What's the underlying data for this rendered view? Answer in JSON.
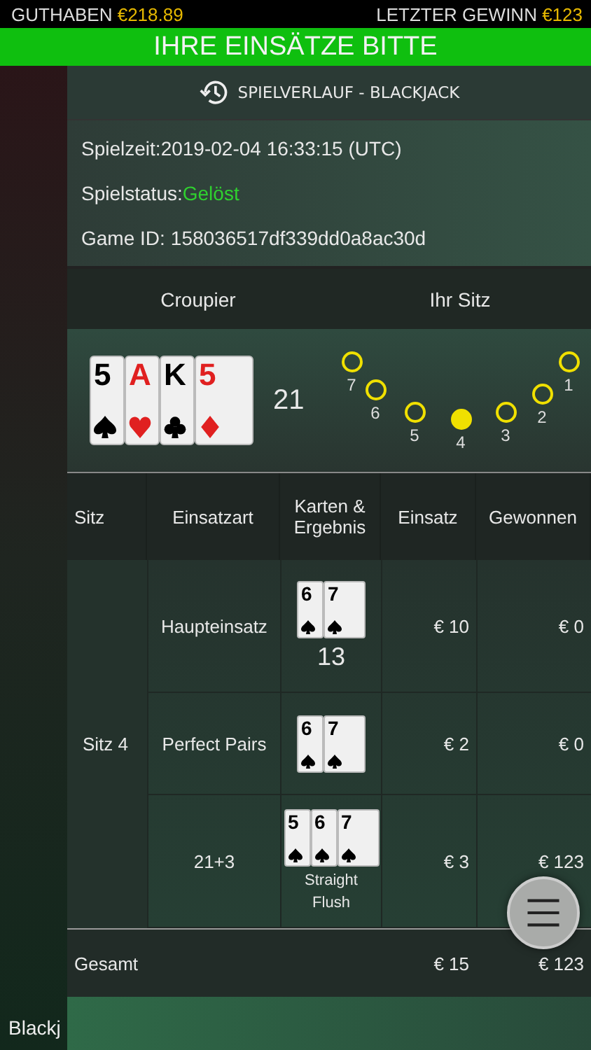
{
  "top_bar": {
    "balance_label": "GUTHABEN",
    "balance": "€218.89",
    "last_win_label": "LETZTER GEWINN",
    "last_win": "€123"
  },
  "banner": "IHRE EINSÄTZE BITTE",
  "panel": {
    "title": "SPIELVERLAUF - BLACKJACK",
    "info": [
      {
        "label": "Spielzeit:",
        "value": "2019-02-04 16:33:15 (UTC)",
        "kind": "plain"
      },
      {
        "label": "Spielstatus:",
        "value": "Gelöst",
        "kind": "status"
      },
      {
        "label": "Game ID:",
        "value": "158036517df339dd0a8ac30d",
        "kind": "plain"
      }
    ],
    "hand": {
      "columns": [
        "Croupier",
        "Ihr Sitz"
      ],
      "dealer_cards": [
        {
          "rank": "5",
          "kind": "spades"
        },
        {
          "rank": "A",
          "kind": "hearts"
        },
        {
          "rank": "K",
          "kind": "clubs"
        },
        {
          "rank": "5",
          "kind": "diamonds"
        }
      ],
      "dealer_total": "21",
      "seats": [
        {
          "label": "1",
          "selected": false
        },
        {
          "label": "2",
          "selected": false
        },
        {
          "label": "3",
          "selected": false
        },
        {
          "label": "4",
          "selected": true
        },
        {
          "label": "5",
          "selected": false
        },
        {
          "label": "6",
          "selected": false
        },
        {
          "label": "7",
          "selected": false
        }
      ]
    },
    "table": {
      "columns": [
        "Sitz",
        "Einsatzart",
        "Karten & Ergebnis",
        "Einsatz",
        "Gewonnen"
      ],
      "seat": "Sitz 4",
      "rows": [
        {
          "bet_type": "Haupteinsatz",
          "cards": [
            {
              "rank": "6",
              "kind": "spades"
            },
            {
              "rank": "7",
              "kind": "spades"
            }
          ],
          "result": "13",
          "stake": "€ 10",
          "won": "€ 0"
        },
        {
          "bet_type": "Perfect Pairs",
          "cards": [
            {
              "rank": "6",
              "kind": "spades"
            },
            {
              "rank": "7",
              "kind": "spades"
            }
          ],
          "stake": "€ 2",
          "won": "€ 0"
        },
        {
          "bet_type": "21+3",
          "cards": [
            {
              "rank": "5",
              "kind": "spades"
            },
            {
              "rank": "6",
              "kind": "spades"
            },
            {
              "rank": "7",
              "kind": "spades"
            }
          ],
          "result": "Straight Flush",
          "stake": "€ 3",
          "won": "€ 123"
        }
      ],
      "total": {
        "label": "Gesamt",
        "stake": "€ 15",
        "won": "€ 123"
      }
    }
  },
  "footer": {
    "table_name": "Blackj"
  }
}
